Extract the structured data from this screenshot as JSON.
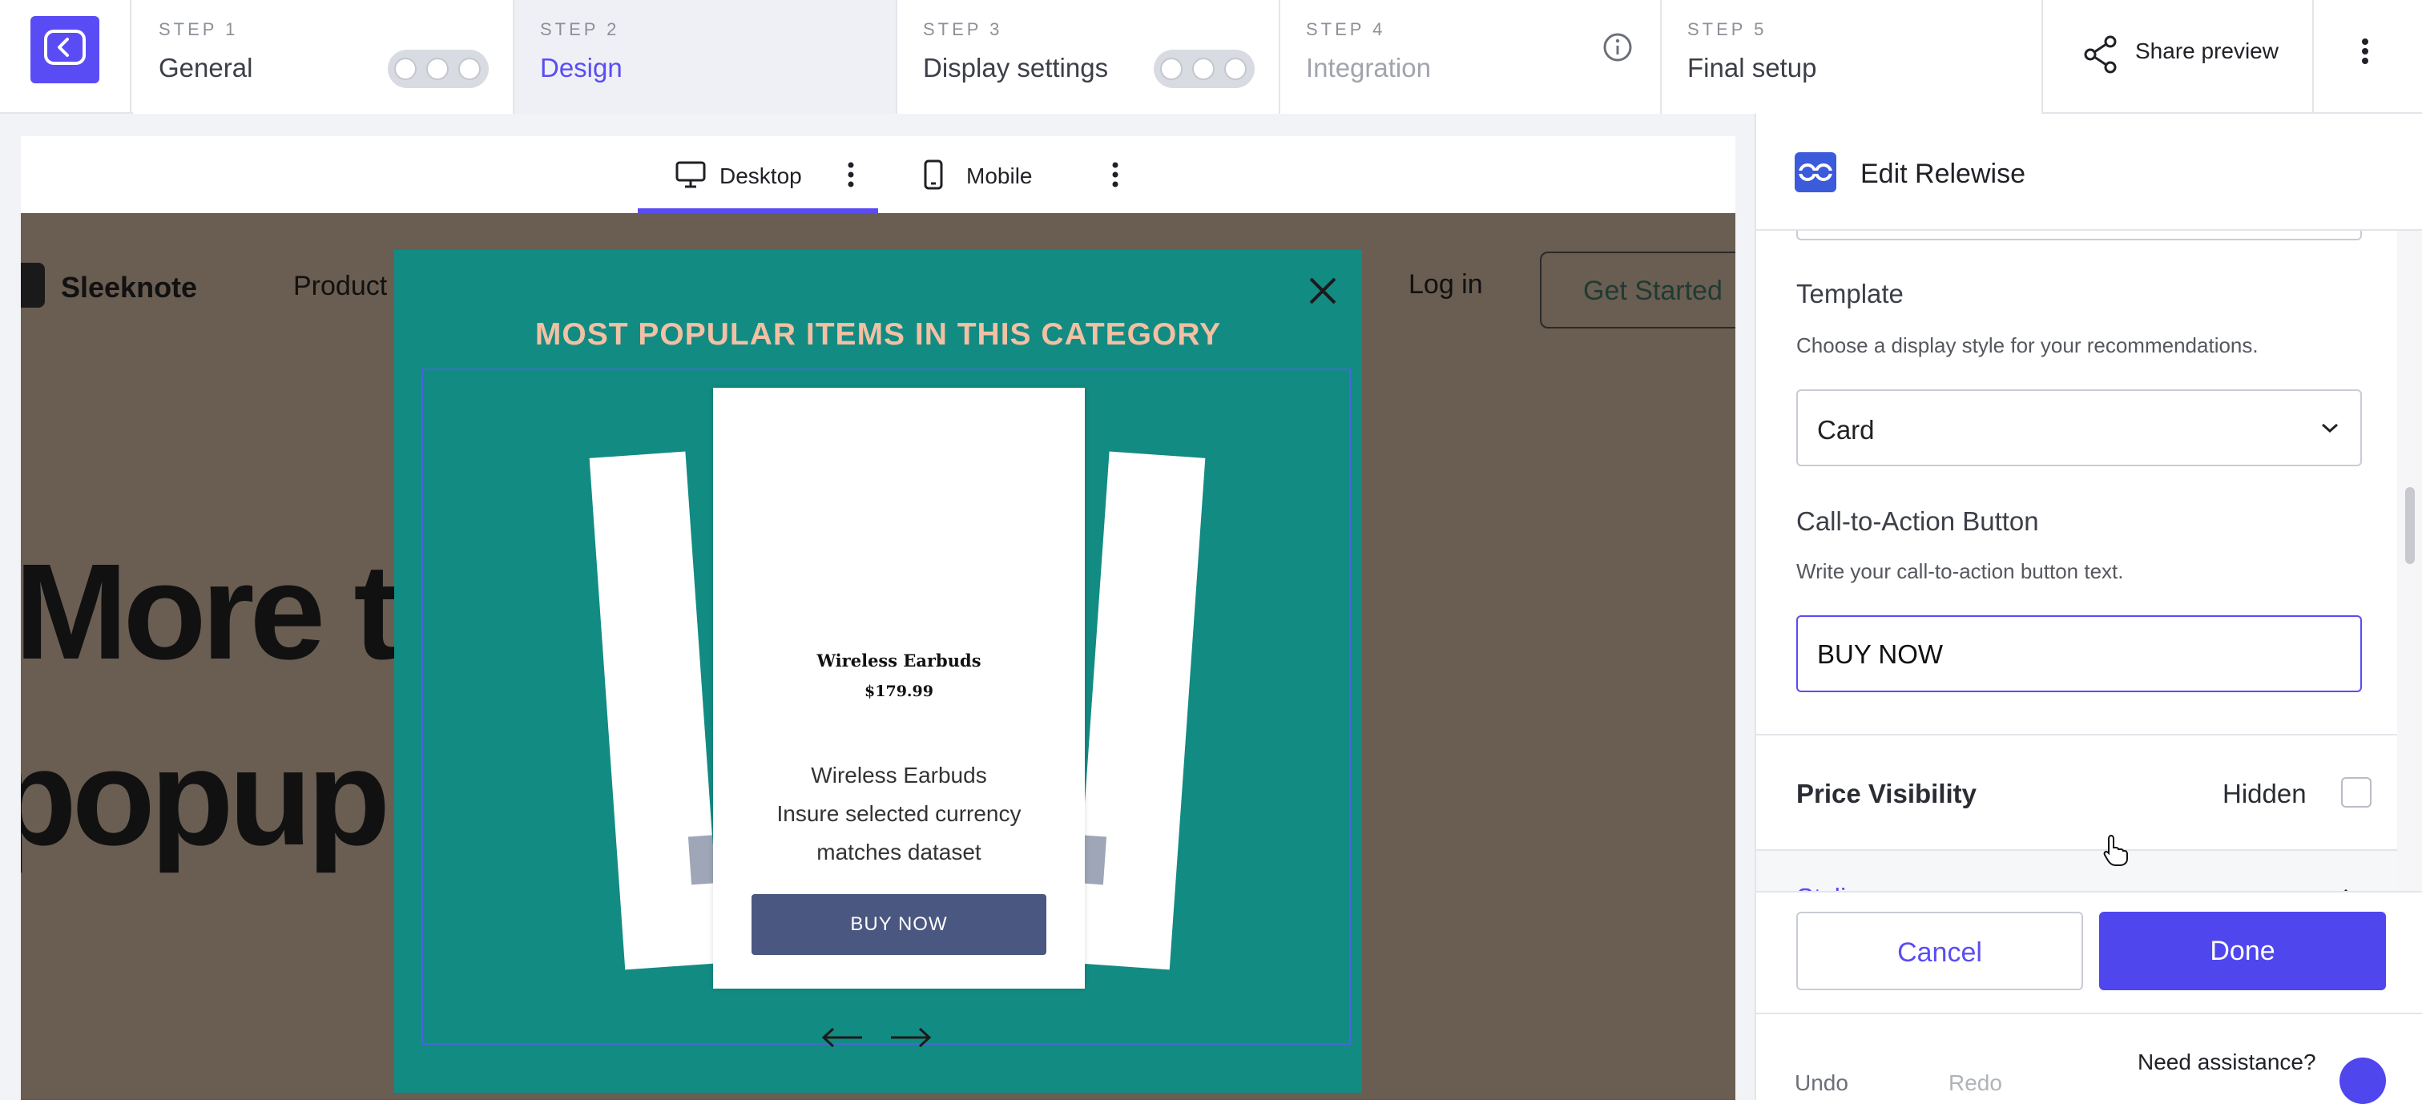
{
  "steps": [
    {
      "num": "STEP 1",
      "title": "General"
    },
    {
      "num": "STEP 2",
      "title": "Design"
    },
    {
      "num": "STEP 3",
      "title": "Display settings"
    },
    {
      "num": "STEP 4",
      "title": "Integration"
    },
    {
      "num": "STEP 5",
      "title": "Final setup"
    }
  ],
  "header": {
    "share_label": "Share preview"
  },
  "preview": {
    "tabs": [
      {
        "label": "Desktop"
      },
      {
        "label": "Mobile"
      }
    ],
    "site": {
      "brand": "Sleeknote",
      "nav_item": "Product",
      "login": "Log in",
      "cta": "Get Started",
      "hero_line1": "More tl",
      "hero_line2": "popup"
    },
    "popup": {
      "heading": "MOST POPULAR ITEMS IN THIS CATEGORY",
      "product_name": "Wireless Earbuds",
      "product_price": "$179.99",
      "description_lines": [
        "Wireless Earbuds",
        "Insure selected currency",
        "matches dataset"
      ],
      "button_label": "BUY NOW"
    }
  },
  "panel": {
    "title": "Edit Relewise",
    "template": {
      "label": "Template",
      "help": "Choose a display style for your recommendations.",
      "selected": "Card"
    },
    "cta_button": {
      "label": "Call-to-Action Button",
      "help": "Write your call-to-action button text.",
      "value": "BUY NOW"
    },
    "price_visibility": {
      "label": "Price Visibility",
      "state_label": "Hidden"
    },
    "styling": {
      "label": "Styling"
    },
    "cancel_label": "Cancel",
    "done_label": "Done",
    "undo_label": "Undo",
    "redo_label": "Redo",
    "assistance": "Need assistance?"
  },
  "colors": {
    "accent": "#5a4cf5",
    "popup_bg": "#128b83",
    "popup_heading": "#f2c0a3",
    "buy_button": "#4a5780",
    "site_bg": "#6a5d52"
  },
  "icons": {
    "logo": "chat-bubble-back-icon",
    "share": "share-icon",
    "info": "info-icon",
    "desktop": "monitor-icon",
    "mobile": "phone-icon",
    "close": "close-icon",
    "editor": "relewise-icon"
  }
}
